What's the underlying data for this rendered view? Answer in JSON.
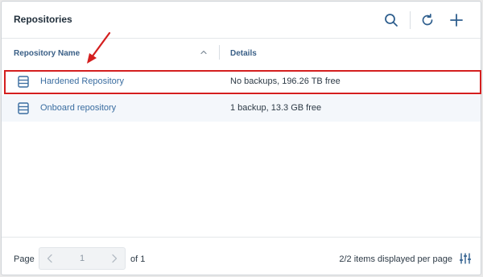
{
  "header": {
    "title": "Repositories",
    "icons": [
      "search-icon",
      "refresh-icon",
      "plus-icon"
    ]
  },
  "table": {
    "columns": [
      "Repository Name",
      "Details"
    ],
    "sort": "ascending",
    "rows": [
      {
        "name": "Hardened Repository",
        "details": "No backups, 196.26 TB free",
        "icon": "repository-icon"
      },
      {
        "name": "Onboard repository",
        "details": "1 backup, 13.3 GB free",
        "icon": "repository-icon"
      }
    ]
  },
  "footer": {
    "page_label": "Page",
    "page_value": "1",
    "of_label": "of 1",
    "items_label": "2/2 items displayed per page"
  },
  "colors": {
    "accent": "#2f6aa6",
    "highlight": "#d41f1f"
  }
}
